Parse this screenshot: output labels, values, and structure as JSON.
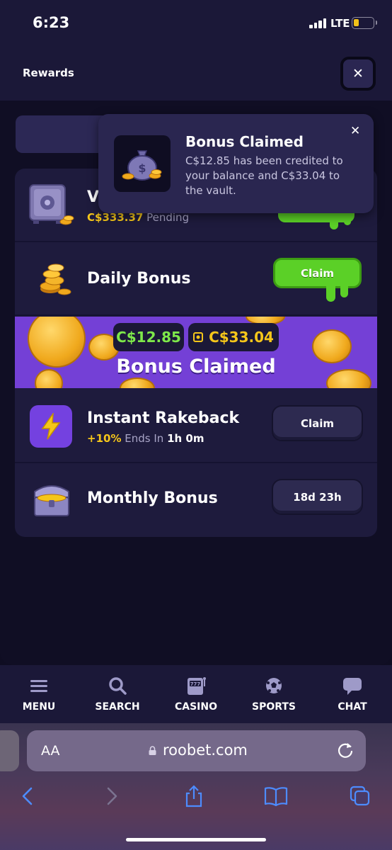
{
  "status_bar": {
    "time": "6:23",
    "network": "LTE"
  },
  "header": {
    "title": "Rewards",
    "close_label": "✕"
  },
  "rows": {
    "vault": {
      "title": "V",
      "amount": "C$333.37",
      "status": "Pending"
    },
    "daily": {
      "title": "Daily Bonus",
      "button": "Claim"
    },
    "rakeback": {
      "title": "Instant Rakeback",
      "percent": "+10%",
      "ends_text": "Ends In",
      "time_left": "1h 0m",
      "button": "Claim"
    },
    "monthly": {
      "title": "Monthly Bonus",
      "countdown": "18d 23h"
    }
  },
  "banner": {
    "balance_amount": "C$12.85",
    "vault_amount": "C$33.04",
    "title": "Bonus Claimed"
  },
  "toast": {
    "title": "Bonus Claimed",
    "message": "C$12.85 has been credited to your balance and C$33.04 to the vault.",
    "close_label": "✕"
  },
  "bottom_nav": [
    {
      "label": "MENU",
      "icon": "menu-icon"
    },
    {
      "label": "SEARCH",
      "icon": "search-icon"
    },
    {
      "label": "CASINO",
      "icon": "slot-machine-icon"
    },
    {
      "label": "SPORTS",
      "icon": "soccer-ball-icon"
    },
    {
      "label": "CHAT",
      "icon": "chat-bubble-icon"
    }
  ],
  "browser": {
    "aa_label": "AA",
    "url": "roobet.com"
  },
  "colors": {
    "accent_green": "#5bd027",
    "gold": "#f5c61a",
    "banner_purple": "#7440d6",
    "rakeback_purple": "#7441e0"
  }
}
